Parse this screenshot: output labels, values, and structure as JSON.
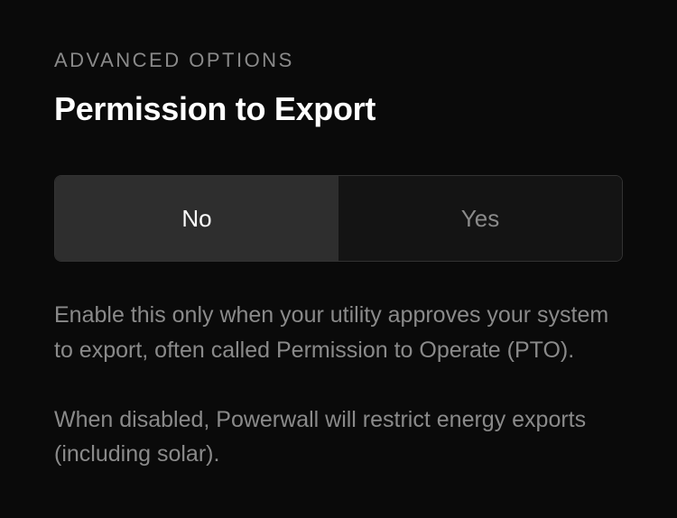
{
  "section_label": "ADVANCED OPTIONS",
  "title": "Permission to Export",
  "toggle": {
    "no_label": "No",
    "yes_label": "Yes",
    "selected": "no"
  },
  "description": {
    "paragraph1": "Enable this only when your utility approves your system to export, often called Permission to Operate (PTO).",
    "paragraph2": "When disabled, Powerwall will restrict energy exports (including solar)."
  }
}
